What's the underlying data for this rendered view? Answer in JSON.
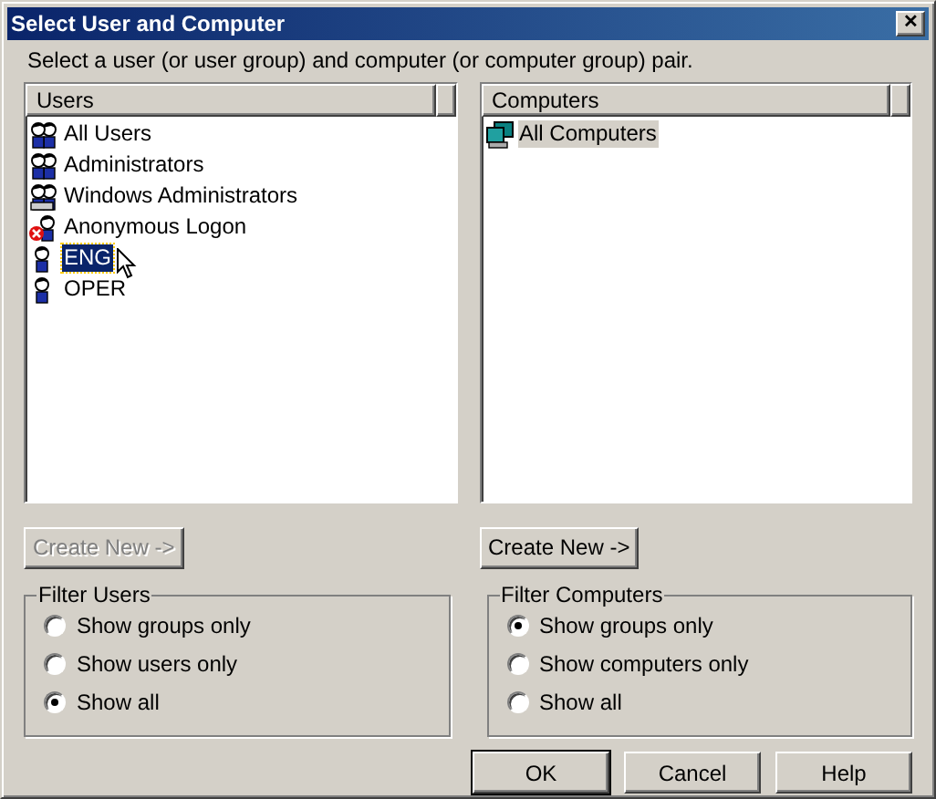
{
  "window": {
    "title": "Select User and Computer",
    "close_glyph": "✕"
  },
  "instruction": "Select a user (or user group) and computer (or computer group) pair.",
  "users": {
    "header": "Users",
    "items": [
      {
        "label": "All Users",
        "kind": "group",
        "selected": false
      },
      {
        "label": "Administrators",
        "kind": "group",
        "selected": false
      },
      {
        "label": "Windows Administrators",
        "kind": "admin",
        "selected": false
      },
      {
        "label": "Anonymous Logon",
        "kind": "anonymous",
        "selected": false
      },
      {
        "label": "ENG",
        "kind": "user",
        "selected": true
      },
      {
        "label": "OPER",
        "kind": "user",
        "selected": false
      }
    ]
  },
  "computers": {
    "header": "Computers",
    "items": [
      {
        "label": "All Computers",
        "kind": "computers",
        "selected": true
      }
    ]
  },
  "create_user_button": {
    "label": "Create New ->",
    "disabled": true
  },
  "create_computer_button": {
    "label": "Create New ->",
    "disabled": false
  },
  "filter_users": {
    "title": "Filter Users",
    "options": [
      {
        "label": "Show groups only",
        "selected": false
      },
      {
        "label": "Show users only",
        "selected": false
      },
      {
        "label": "Show all",
        "selected": true
      }
    ]
  },
  "filter_computers": {
    "title": "Filter Computers",
    "options": [
      {
        "label": "Show groups only",
        "selected": true
      },
      {
        "label": "Show computers only",
        "selected": false
      },
      {
        "label": "Show all",
        "selected": false
      }
    ]
  },
  "buttons": [
    {
      "label": "OK",
      "default": true
    },
    {
      "label": "Cancel",
      "default": false
    },
    {
      "label": "Help",
      "default": false
    }
  ]
}
